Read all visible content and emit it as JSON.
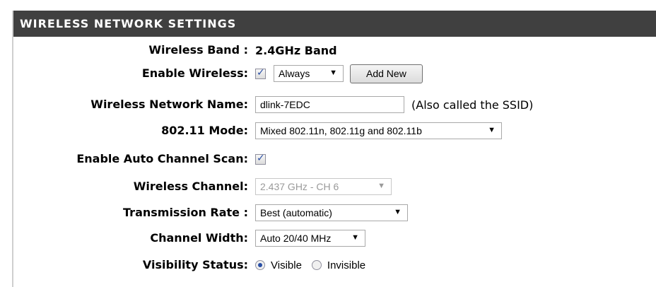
{
  "section": {
    "title": "WIRELESS NETWORK SETTINGS"
  },
  "rows": {
    "wireless_band": {
      "label": "Wireless Band :",
      "value": "2.4GHz Band"
    },
    "enable_wireless": {
      "label": "Enable Wireless:",
      "checked": true,
      "schedule": "Always",
      "add_new": "Add New"
    },
    "network_name": {
      "label": "Wireless Network Name:",
      "value": "dlink-7EDC",
      "note": "(Also called the SSID)"
    },
    "mode": {
      "label": "802.11 Mode:",
      "value": "Mixed 802.11n, 802.11g and 802.11b"
    },
    "auto_channel": {
      "label": "Enable Auto Channel Scan:",
      "checked": true
    },
    "channel": {
      "label": "Wireless Channel:",
      "value": "2.437 GHz - CH 6",
      "disabled": true
    },
    "transmission_rate": {
      "label": "Transmission Rate :",
      "value": "Best (automatic)"
    },
    "channel_width": {
      "label": "Channel Width:",
      "value": "Auto 20/40 MHz"
    },
    "visibility": {
      "label": "Visibility Status:",
      "options": [
        "Visible",
        "Invisible"
      ],
      "selected": "Visible"
    }
  },
  "colors": {
    "header_bg": "#404040",
    "header_text": "#ffffff",
    "accent": "#2a4fa5"
  }
}
